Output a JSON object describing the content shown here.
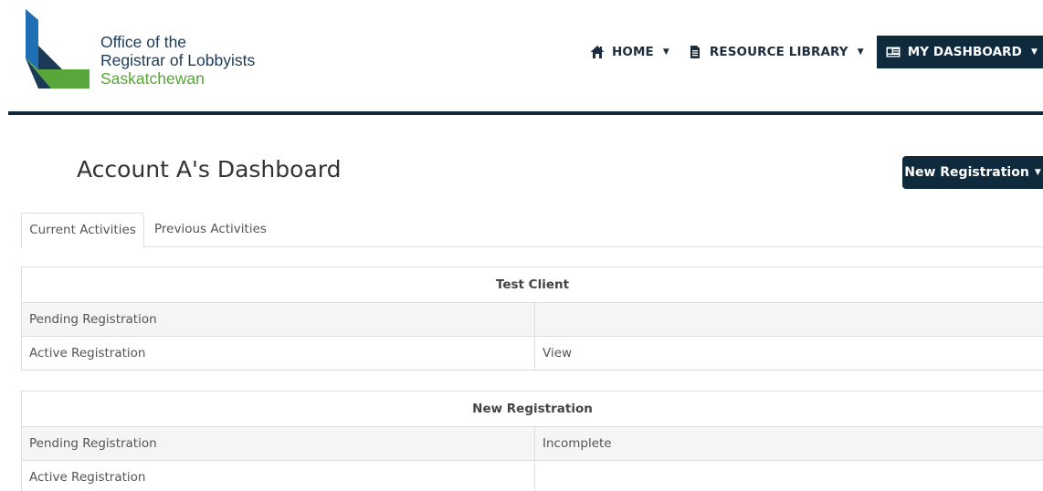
{
  "header": {
    "org_line1": "Office of the",
    "org_line2": "Registrar of Lobbyists",
    "org_line3": "Saskatchewan",
    "nav": [
      {
        "label": "HOME",
        "icon": "home-icon"
      },
      {
        "label": "RESOURCE LIBRARY",
        "icon": "document-icon"
      },
      {
        "label": "MY DASHBOARD",
        "icon": "id-card-icon"
      }
    ]
  },
  "colors": {
    "brand_navy": "#0f2a3c",
    "logo_blue": "#1f6fb5",
    "logo_green": "#59a63b"
  },
  "page": {
    "title": "Account A's Dashboard",
    "new_registration_label": "New Registration"
  },
  "tabs": [
    {
      "label": "Current Activities",
      "active": true
    },
    {
      "label": "Previous Activities",
      "active": false
    }
  ],
  "tables": [
    {
      "heading": "Test Client",
      "rows": [
        {
          "label": "Pending Registration",
          "value": ""
        },
        {
          "label": "Active Registration",
          "value": "View"
        }
      ]
    },
    {
      "heading": "New Registration",
      "rows": [
        {
          "label": "Pending Registration",
          "value": "Incomplete"
        },
        {
          "label": "Active Registration",
          "value": ""
        }
      ]
    }
  ]
}
